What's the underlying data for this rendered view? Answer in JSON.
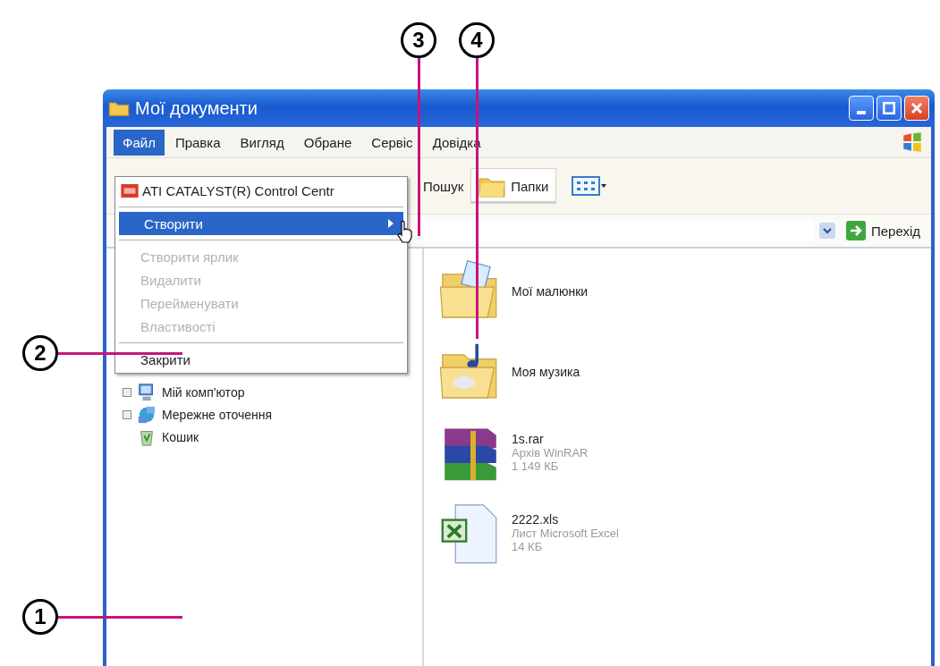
{
  "window": {
    "title": "Мої документи"
  },
  "menu_bar": [
    {
      "label": "Файл",
      "selected": true
    },
    {
      "label": "Правка",
      "selected": false
    },
    {
      "label": "Вигляд",
      "selected": false
    },
    {
      "label": "Обране",
      "selected": false
    },
    {
      "label": "Сервіс",
      "selected": false
    },
    {
      "label": "Довідка",
      "selected": false
    }
  ],
  "file_menu": [
    {
      "kind": "app",
      "label": "ATI CATALYST(R) Control Centr",
      "disabled": false,
      "selected": false
    },
    {
      "kind": "separator"
    },
    {
      "kind": "submenu",
      "label": "Створити",
      "disabled": false,
      "selected": true
    },
    {
      "kind": "separator"
    },
    {
      "kind": "item",
      "label": "Створити ярлик",
      "disabled": true,
      "selected": false
    },
    {
      "kind": "item",
      "label": "Видалити",
      "disabled": true,
      "selected": false
    },
    {
      "kind": "item",
      "label": "Перейменувати",
      "disabled": true,
      "selected": false
    },
    {
      "kind": "item",
      "label": "Властивості",
      "disabled": true,
      "selected": false
    },
    {
      "kind": "separator"
    },
    {
      "kind": "item",
      "label": "Закрити",
      "disabled": false,
      "selected": false
    }
  ],
  "toolbar": {
    "search_label": "Пошук",
    "folders_button": {
      "label": "Папки",
      "pressed": true
    }
  },
  "address_bar": {
    "go_button": "Перехід"
  },
  "folder_tree": [
    {
      "kind": "computer",
      "label": "Мій комп'ютор",
      "expandable": true
    },
    {
      "kind": "network",
      "label": "Мережне оточення",
      "expandable": true
    },
    {
      "kind": "recycle",
      "label": "Кошик",
      "expandable": false
    }
  ],
  "files": [
    {
      "kind": "pictures",
      "name": "Мої малюнки"
    },
    {
      "kind": "music",
      "name": "Моя музика"
    },
    {
      "kind": "archive",
      "name": "1s.rar",
      "type": "Архів WinRAR",
      "size": "1 149 КБ"
    },
    {
      "kind": "excel",
      "name": "2222.xls",
      "type": "Лист Microsoft Excel",
      "size": "14 КБ"
    }
  ],
  "callouts": [
    {
      "number": "1"
    },
    {
      "number": "2"
    },
    {
      "number": "3"
    },
    {
      "number": "4"
    }
  ]
}
